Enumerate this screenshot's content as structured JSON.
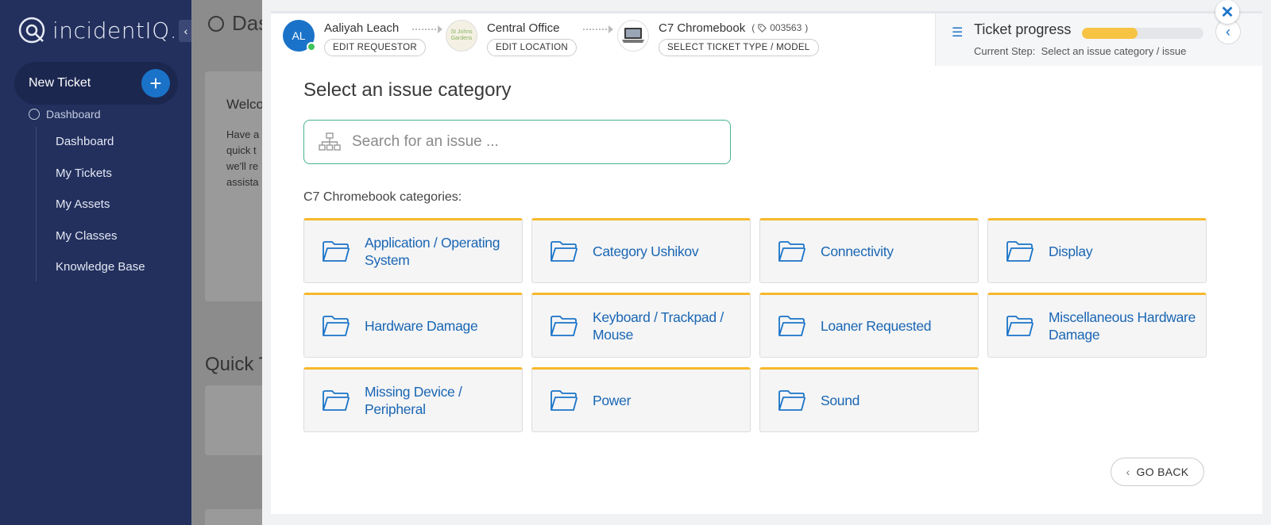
{
  "sidebar": {
    "logo_text": "incidentIQ.",
    "collapse_icon": "chevron-left-icon",
    "new_ticket_label": "New Ticket",
    "section_label": "Dashboard",
    "items": [
      {
        "label": "Dashboard"
      },
      {
        "label": "My Tickets"
      },
      {
        "label": "My Assets"
      },
      {
        "label": "My Classes"
      },
      {
        "label": "Knowledge Base"
      }
    ]
  },
  "background": {
    "page_title": "Das",
    "welcome": "Welco",
    "text": "Have a\nquick t\nwe'll re\nassista",
    "quick_title": "Quick T"
  },
  "wizard": {
    "requestor": {
      "name": "Aaliyah Leach",
      "initials": "AL",
      "button": "EDIT REQUESTOR"
    },
    "location": {
      "name": "Central Office",
      "image_text": "St Johns Gardens",
      "button": "EDIT LOCATION"
    },
    "asset": {
      "name": "C7 Chromebook",
      "tag_open": "(",
      "tag": "003563",
      "tag_close": ")",
      "button": "SELECT TICKET TYPE / MODEL"
    },
    "progress": {
      "title": "Ticket progress",
      "value": 0.46,
      "current_step_label": "Current Step:",
      "current_step": "Select an issue category / issue"
    }
  },
  "content": {
    "title": "Select an issue category",
    "search_placeholder": "Search for an issue ...",
    "categories_label": "C7 Chromebook categories:",
    "categories": [
      {
        "label": "Application / Operating System"
      },
      {
        "label": "Category Ushikov"
      },
      {
        "label": "Connectivity"
      },
      {
        "label": "Display"
      },
      {
        "label": "Hardware Damage"
      },
      {
        "label": "Keyboard / Trackpad / Mouse"
      },
      {
        "label": "Loaner Requested"
      },
      {
        "label": "Miscellaneous Hardware Damage"
      },
      {
        "label": "Missing Device / Peripheral"
      },
      {
        "label": "Power"
      },
      {
        "label": "Sound"
      }
    ],
    "go_back": "GO BACK"
  },
  "colors": {
    "sidebar_bg": "#23305e",
    "accent": "#1a73c8",
    "card_top": "#f6b82b",
    "progress_fill": "#f6c343",
    "search_border": "#47b38b"
  }
}
